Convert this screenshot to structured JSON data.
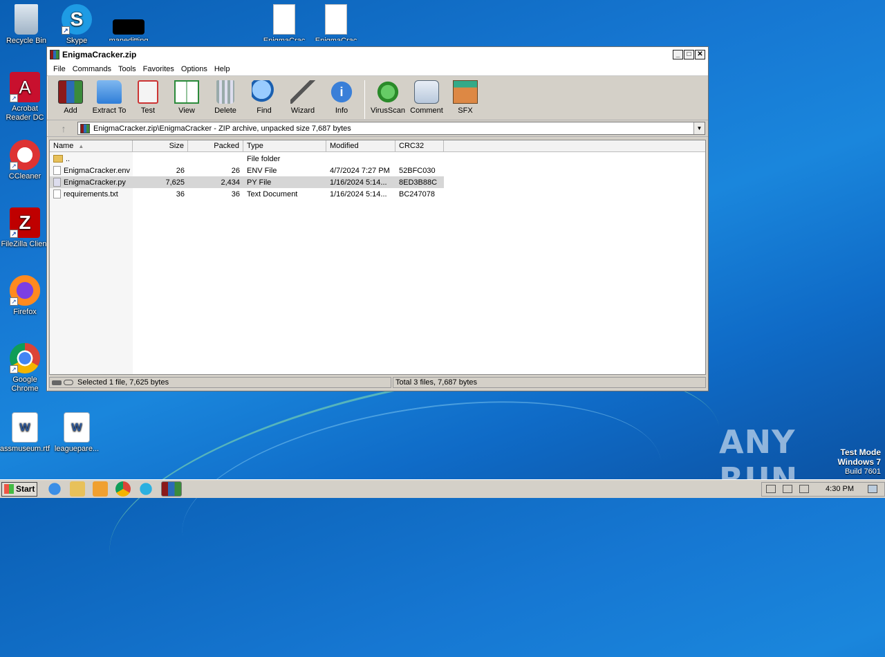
{
  "desktop": {
    "icons": [
      {
        "label": "Recycle Bin"
      },
      {
        "label": "Skype"
      },
      {
        "label": "maneditting"
      },
      {
        "label": "EnigmaCrac"
      },
      {
        "label": "EnigmaCrac"
      },
      {
        "label": "Acrobat Reader DC"
      },
      {
        "label": "CCleaner"
      },
      {
        "label": "FileZilla Client"
      },
      {
        "label": "Firefox"
      },
      {
        "label": "Google Chrome"
      },
      {
        "label": "assmuseum.rtf"
      },
      {
        "label": "leaguepare..."
      }
    ],
    "watermark": {
      "line1": "Test Mode",
      "line2": "Windows 7",
      "line3": "Build 7601"
    },
    "brand": "ANY RUN"
  },
  "window": {
    "title": "EnigmaCracker.zip",
    "menu": [
      "File",
      "Commands",
      "Tools",
      "Favorites",
      "Options",
      "Help"
    ],
    "toolbar": [
      "Add",
      "Extract To",
      "Test",
      "View",
      "Delete",
      "Find",
      "Wizard",
      "Info",
      "VirusScan",
      "Comment",
      "SFX"
    ],
    "address": "EnigmaCracker.zip\\EnigmaCracker - ZIP archive, unpacked size 7,687 bytes",
    "columns": [
      "Name",
      "Size",
      "Packed",
      "Type",
      "Modified",
      "CRC32"
    ],
    "rows": [
      {
        "name": "..",
        "size": "",
        "packed": "",
        "type": "File folder",
        "modified": "",
        "crc": ""
      },
      {
        "name": "EnigmaCracker.env",
        "size": "26",
        "packed": "26",
        "type": "ENV File",
        "modified": "4/7/2024 7:27 PM",
        "crc": "52BFC030"
      },
      {
        "name": "EnigmaCracker.py",
        "size": "7,625",
        "packed": "2,434",
        "type": "PY File",
        "modified": "1/16/2024 5:14...",
        "crc": "8ED3B88C"
      },
      {
        "name": "requirements.txt",
        "size": "36",
        "packed": "36",
        "type": "Text Document",
        "modified": "1/16/2024 5:14...",
        "crc": "BC247078"
      }
    ],
    "status_left": "Selected 1 file, 7,625 bytes",
    "status_right": "Total 3 files, 7,687 bytes"
  },
  "taskbar": {
    "start": "Start",
    "clock": "4:30 PM"
  }
}
